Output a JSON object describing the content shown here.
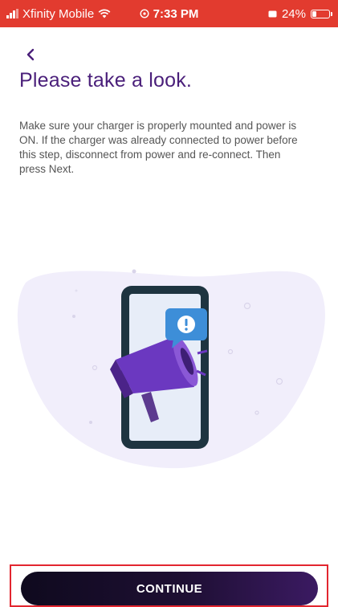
{
  "status_bar": {
    "carrier": "Xfinity Mobile",
    "time": "7:33 PM",
    "battery": "24%",
    "battery_level": 0.24,
    "icons": [
      "signal-icon",
      "wifi-icon",
      "location-icon",
      "battery-saver-icon",
      "battery-icon"
    ],
    "background_color": "#e23b2f"
  },
  "nav": {
    "back_icon": "chevron-left-icon"
  },
  "page": {
    "title": "Please take a look.",
    "body": "Make sure your charger is properly mounted and power is ON. If the charger was already connected to power before this step, disconnect from power and re-connect. Then press Next."
  },
  "illustration": {
    "subject": "phone-with-megaphone-illustration",
    "badge_icon": "alert-exclamation-icon"
  },
  "actions": {
    "continue_label": "CONTINUE"
  },
  "colors": {
    "title": "#4a1f7a",
    "accent_purple": "#5b2a9c",
    "alert_blue": "#3d8ed8",
    "blob": "#f1eefb",
    "button_dark": "#120b22",
    "highlight_frame": "#e2262f"
  }
}
